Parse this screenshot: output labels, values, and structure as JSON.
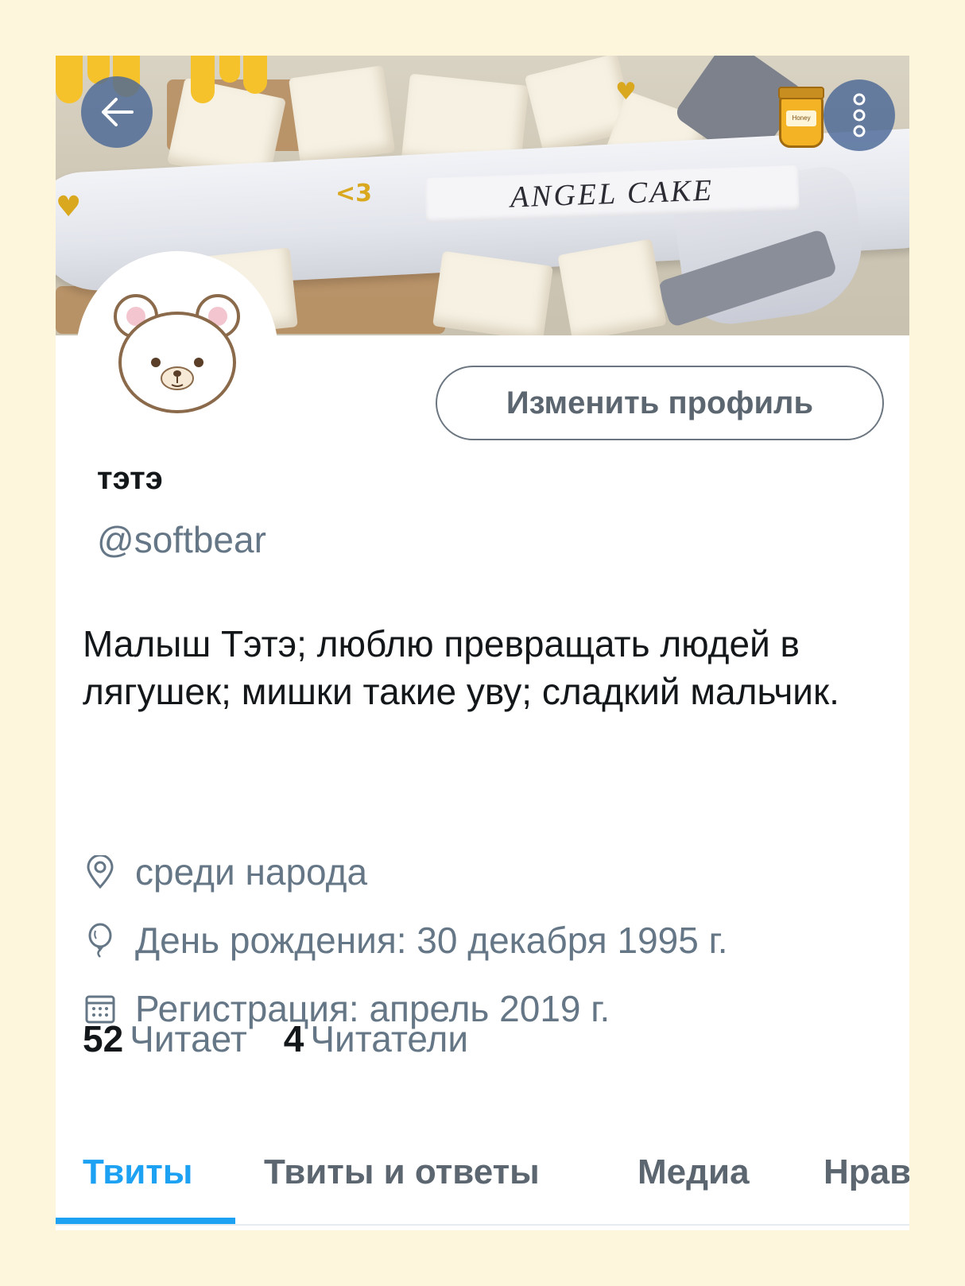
{
  "banner": {
    "spoon_text": "ANGEL CAKE",
    "doodle_text": "<3",
    "honey_label": "Honey",
    "back_icon": "arrow-left-icon",
    "more_icon": "more-vertical-icon"
  },
  "profile": {
    "edit_button": "Изменить профиль",
    "name": "тэтэ",
    "handle": "@softbear",
    "bio": "Малыш Тэтэ; люблю превращать людей в лягушек; мишки такие уву; сладкий мальчик.",
    "location": "среди народа",
    "birthday": "День рождения: 30 декабря 1995 г.",
    "joined": "Регистрация: апрель 2019 г.",
    "following_count": "52",
    "following_label": "Читает",
    "followers_count": "4",
    "followers_label": "Читатели"
  },
  "tabs": [
    {
      "label": "Твиты",
      "active": true
    },
    {
      "label": "Твиты и ответы",
      "active": false
    },
    {
      "label": "Медиа",
      "active": false
    },
    {
      "label": "Нрав",
      "active": false
    }
  ],
  "colors": {
    "accent": "#1da1f2",
    "secondary_text": "#657786",
    "page_background": "#fdf6dc",
    "honey": "#f6c22c"
  }
}
